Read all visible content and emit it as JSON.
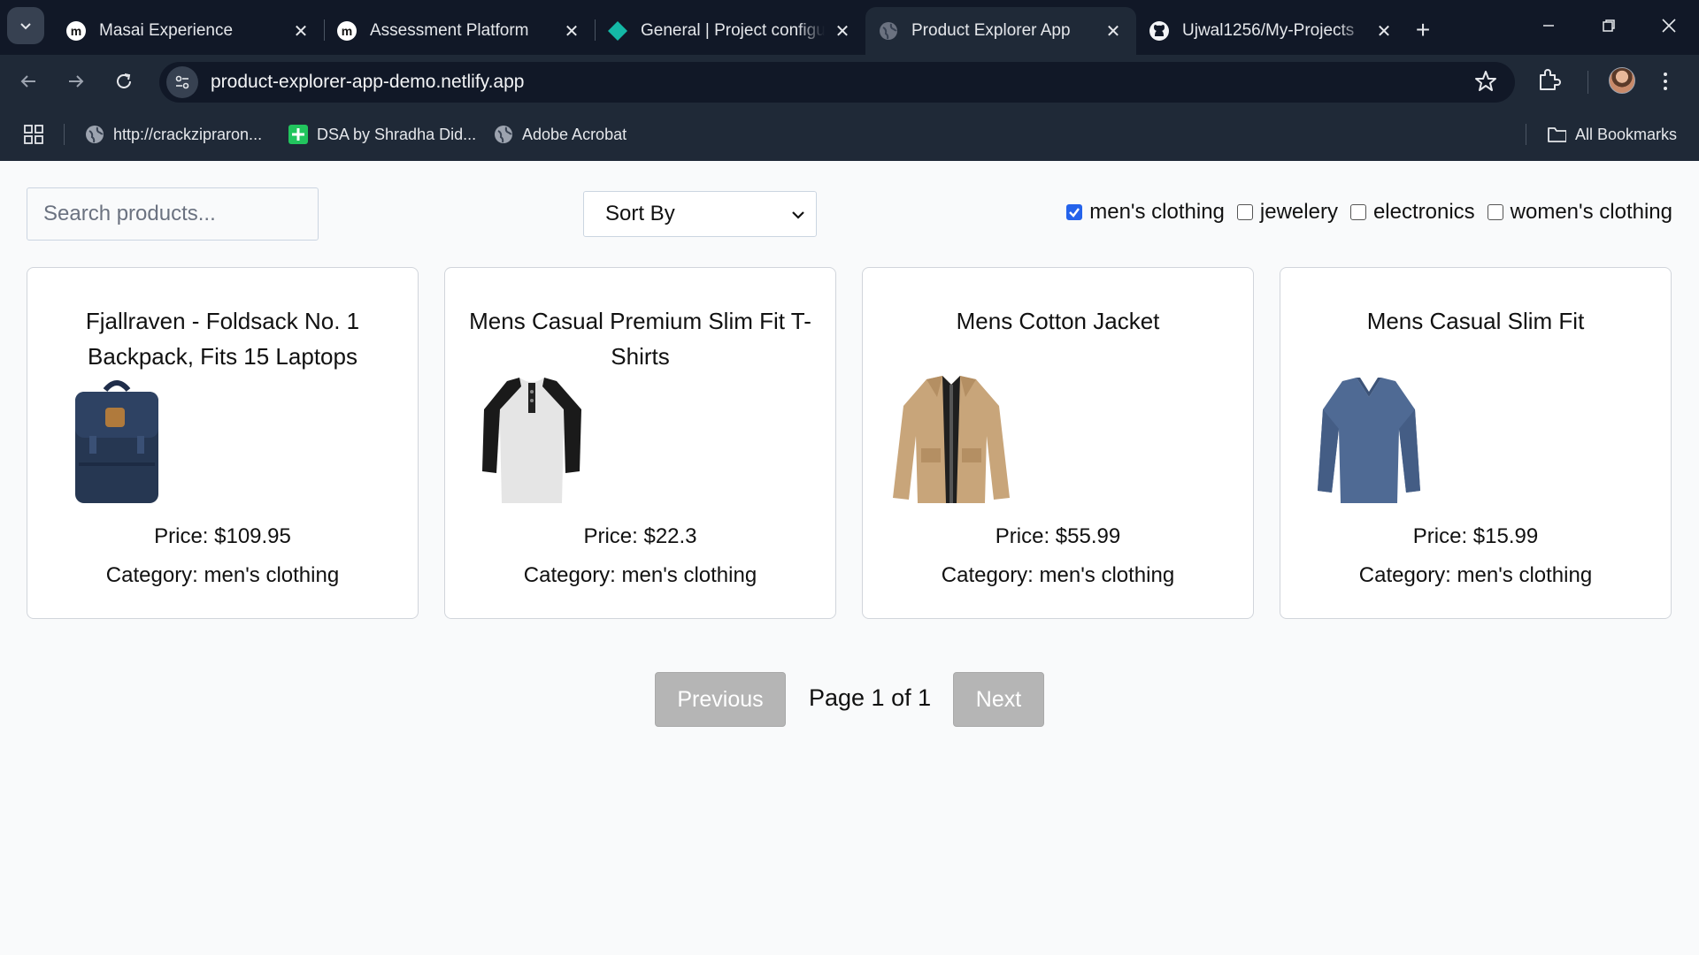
{
  "browser": {
    "tabs": [
      {
        "title": "Masai Experience",
        "icon": "masai-icon",
        "active": false
      },
      {
        "title": "Assessment Platform",
        "icon": "masai-icon",
        "active": false
      },
      {
        "title": "General | Project configu",
        "icon": "diamond-icon",
        "active": false
      },
      {
        "title": "Product Explorer App",
        "icon": "globe-icon",
        "active": true
      },
      {
        "title": "Ujwal1256/My-Projects",
        "icon": "github-icon",
        "active": false
      }
    ],
    "url": "product-explorer-app-demo.netlify.app",
    "bookmarks": [
      {
        "label": "http://crackzipraron...",
        "icon": "globe-icon"
      },
      {
        "label": "DSA by Shradha Did...",
        "icon": "green-plus-icon"
      },
      {
        "label": "Adobe Acrobat",
        "icon": "globe-icon"
      }
    ],
    "all_bookmarks_label": "All Bookmarks"
  },
  "controls": {
    "search_placeholder": "Search products...",
    "sort_label": "Sort By",
    "filters": [
      {
        "label": "men's clothing",
        "checked": true
      },
      {
        "label": "jewelery",
        "checked": false
      },
      {
        "label": "electronics",
        "checked": false
      },
      {
        "label": "women's clothing",
        "checked": false
      }
    ]
  },
  "products": [
    {
      "title": "Fjallraven - Foldsack No. 1 Backpack, Fits 15 Laptops",
      "price": "Price: $109.95",
      "category": "Category: men's clothing",
      "image": "backpack"
    },
    {
      "title": "Mens Casual Premium Slim Fit T-Shirts",
      "price": "Price: $22.3",
      "category": "Category: men's clothing",
      "image": "tshirt"
    },
    {
      "title": "Mens Cotton Jacket",
      "price": "Price: $55.99",
      "category": "Category: men's clothing",
      "image": "jacket"
    },
    {
      "title": "Mens Casual Slim Fit",
      "price": "Price: $15.99",
      "category": "Category: men's clothing",
      "image": "longsleeve"
    }
  ],
  "pagination": {
    "previous_label": "Previous",
    "page_info": "Page 1 of 1",
    "next_label": "Next"
  }
}
